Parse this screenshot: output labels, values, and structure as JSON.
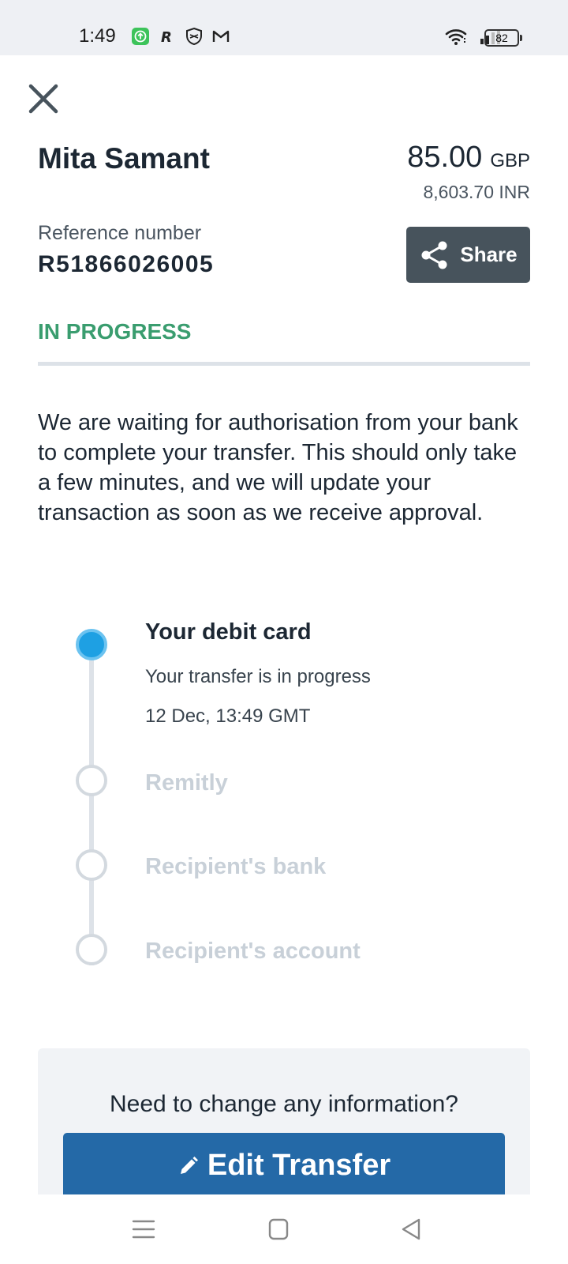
{
  "status_bar": {
    "time": "1:49",
    "battery": "82",
    "left_icons": [
      "upload-app-icon",
      "r-app-icon",
      "shield-app-icon",
      "gmail-icon"
    ],
    "right_icons": [
      "wifi-icon",
      "signal-icon",
      "battery-icon"
    ]
  },
  "transfer": {
    "recipient_name": "Mita Samant",
    "amount": "85.00",
    "currency": "GBP",
    "converted_amount": "8,603.70 INR",
    "reference_label": "Reference number",
    "reference_number": "R51866026005",
    "status": "IN PROGRESS",
    "status_color": "#3a9d6f",
    "description": "We are waiting for authorisation from your bank to complete your transfer. This should only take a few minutes, and we will update your transaction as soon as we receive approval."
  },
  "share_button": {
    "label": "Share",
    "icon": "share-icon"
  },
  "timeline": {
    "steps": [
      {
        "title": "Your debit card",
        "subtitle": "Your transfer is in progress",
        "timestamp": "12 Dec, 13:49 GMT",
        "state": "active"
      },
      {
        "title": "Remitly",
        "state": "pending"
      },
      {
        "title": "Recipient's bank",
        "state": "pending"
      },
      {
        "title": "Recipient's account",
        "state": "pending"
      }
    ]
  },
  "change_card": {
    "question": "Need to change any information?",
    "edit_label": "Edit Transfer",
    "edit_icon": "pencil-icon"
  },
  "colors": {
    "primary_button": "#2469a7",
    "share_button": "#47535c",
    "active_node": "#1ea0e3"
  },
  "nav_bar": {
    "items": [
      "menu-icon",
      "home-icon",
      "back-icon"
    ]
  }
}
